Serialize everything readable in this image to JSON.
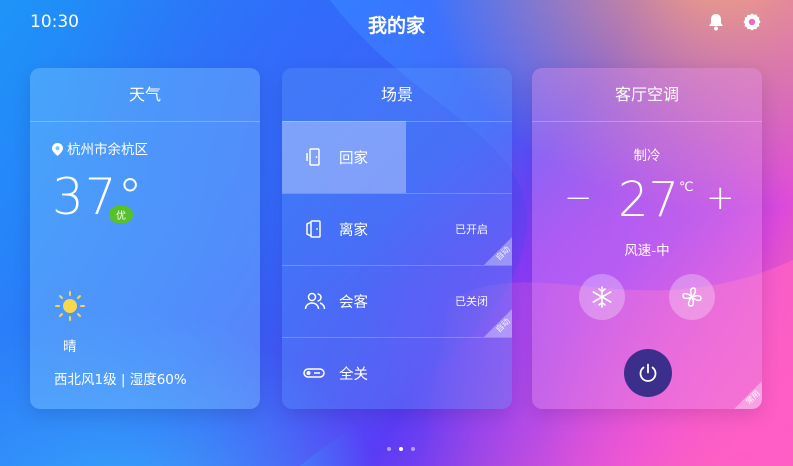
{
  "status_bar": {
    "time": "10:30",
    "title": "我的家",
    "icons": [
      "bell-icon",
      "gear-icon"
    ]
  },
  "weather": {
    "header": "天气",
    "location": "杭州市余杭区",
    "temperature": "37°",
    "aqi_badge": "优",
    "condition": "晴",
    "wind_humidity": "西北风1级 | 湿度60%",
    "icon": "sun-icon"
  },
  "scenes": {
    "header": "场景",
    "items": [
      {
        "label": "回家",
        "status": "",
        "icon": "home-door-icon",
        "active": true,
        "tag": ""
      },
      {
        "label": "离家",
        "status": "已开启",
        "icon": "leave-door-icon",
        "active": false,
        "tag": "自动"
      },
      {
        "label": "会客",
        "status": "已关闭",
        "icon": "guests-icon",
        "active": false,
        "tag": "自动"
      },
      {
        "label": "全关",
        "status": "",
        "icon": "switch-off-icon",
        "active": false,
        "tag": ""
      }
    ]
  },
  "ac": {
    "header": "客厅空调",
    "mode": "制冷",
    "minus": "−",
    "temperature": "27",
    "unit": "℃",
    "plus": "+",
    "fan_speed": "风速-中",
    "tag": "常用",
    "buttons": [
      "snowflake-icon",
      "fan-icon",
      "power-icon"
    ]
  },
  "pager": {
    "count": 3,
    "current": 2
  },
  "colors": {
    "aqi_good": "#58c02b",
    "power_button": "#3c2f8c"
  }
}
